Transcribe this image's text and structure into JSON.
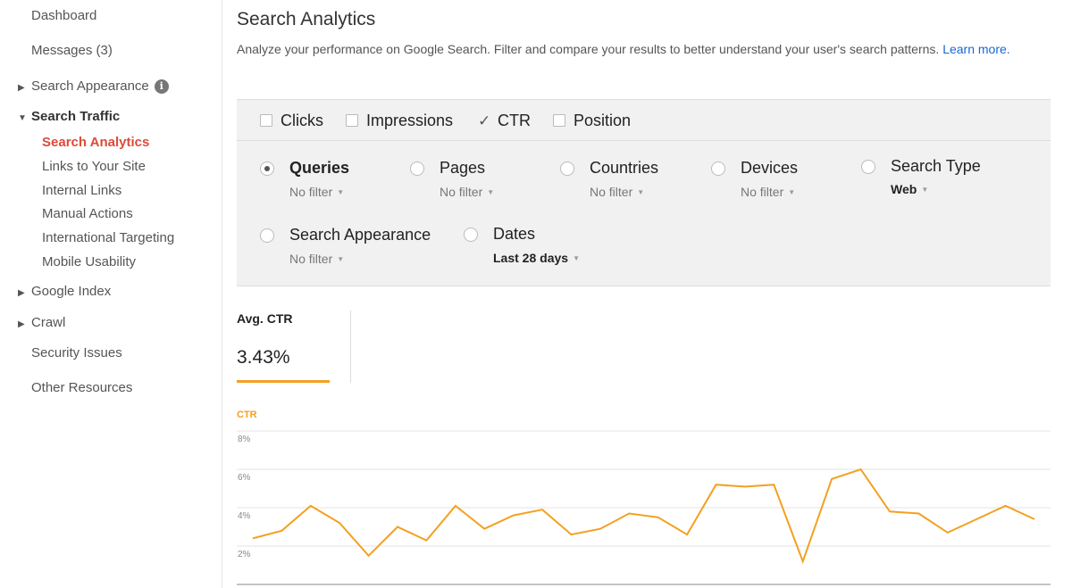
{
  "sidebar": {
    "dashboard": "Dashboard",
    "messages": "Messages (3)",
    "search_appearance": "Search Appearance",
    "search_traffic": "Search Traffic",
    "traffic_items": [
      "Search Analytics",
      "Links to Your Site",
      "Internal Links",
      "Manual Actions",
      "International Targeting",
      "Mobile Usability"
    ],
    "google_index": "Google Index",
    "crawl": "Crawl",
    "security_issues": "Security Issues",
    "other_resources": "Other Resources"
  },
  "header": {
    "title": "Search Analytics",
    "description": "Analyze your performance on Google Search. Filter and compare your results to better understand your user's search patterns.",
    "learn_more": "Learn more."
  },
  "metrics": [
    {
      "label": "Clicks",
      "checked": false
    },
    {
      "label": "Impressions",
      "checked": false
    },
    {
      "label": "CTR",
      "checked": true
    },
    {
      "label": "Position",
      "checked": false
    }
  ],
  "dimensions": [
    {
      "label": "Queries",
      "filter": "No filter",
      "selected": true
    },
    {
      "label": "Pages",
      "filter": "No filter",
      "selected": false
    },
    {
      "label": "Countries",
      "filter": "No filter",
      "selected": false
    },
    {
      "label": "Devices",
      "filter": "No filter",
      "selected": false
    },
    {
      "label": "Search Type",
      "filter": "Web",
      "selected": false
    },
    {
      "label": "Search Appearance",
      "filter": "No filter",
      "selected": false
    },
    {
      "label": "Dates",
      "filter": "Last 28 days",
      "selected": false
    }
  ],
  "stat": {
    "label": "Avg. CTR",
    "value": "3.43%"
  },
  "colors": {
    "accent": "#f4a020",
    "active_nav": "#dd4b39",
    "link": "#1a66d2"
  },
  "chart_data": {
    "type": "line",
    "title": "CTR",
    "ylim": [
      0,
      8
    ],
    "yticks": [
      "8%",
      "6%",
      "4%",
      "2%"
    ],
    "grid": true,
    "series": [
      {
        "values": [
          2.4,
          2.8,
          4.1,
          3.2,
          1.5,
          3.0,
          2.3,
          4.1,
          2.9,
          3.6,
          3.9,
          2.6,
          2.9,
          3.7,
          3.5,
          2.6,
          5.2,
          5.1,
          5.2,
          1.2,
          5.5,
          6.0,
          3.8,
          3.7,
          2.7,
          3.4,
          4.1,
          3.4
        ]
      }
    ]
  }
}
